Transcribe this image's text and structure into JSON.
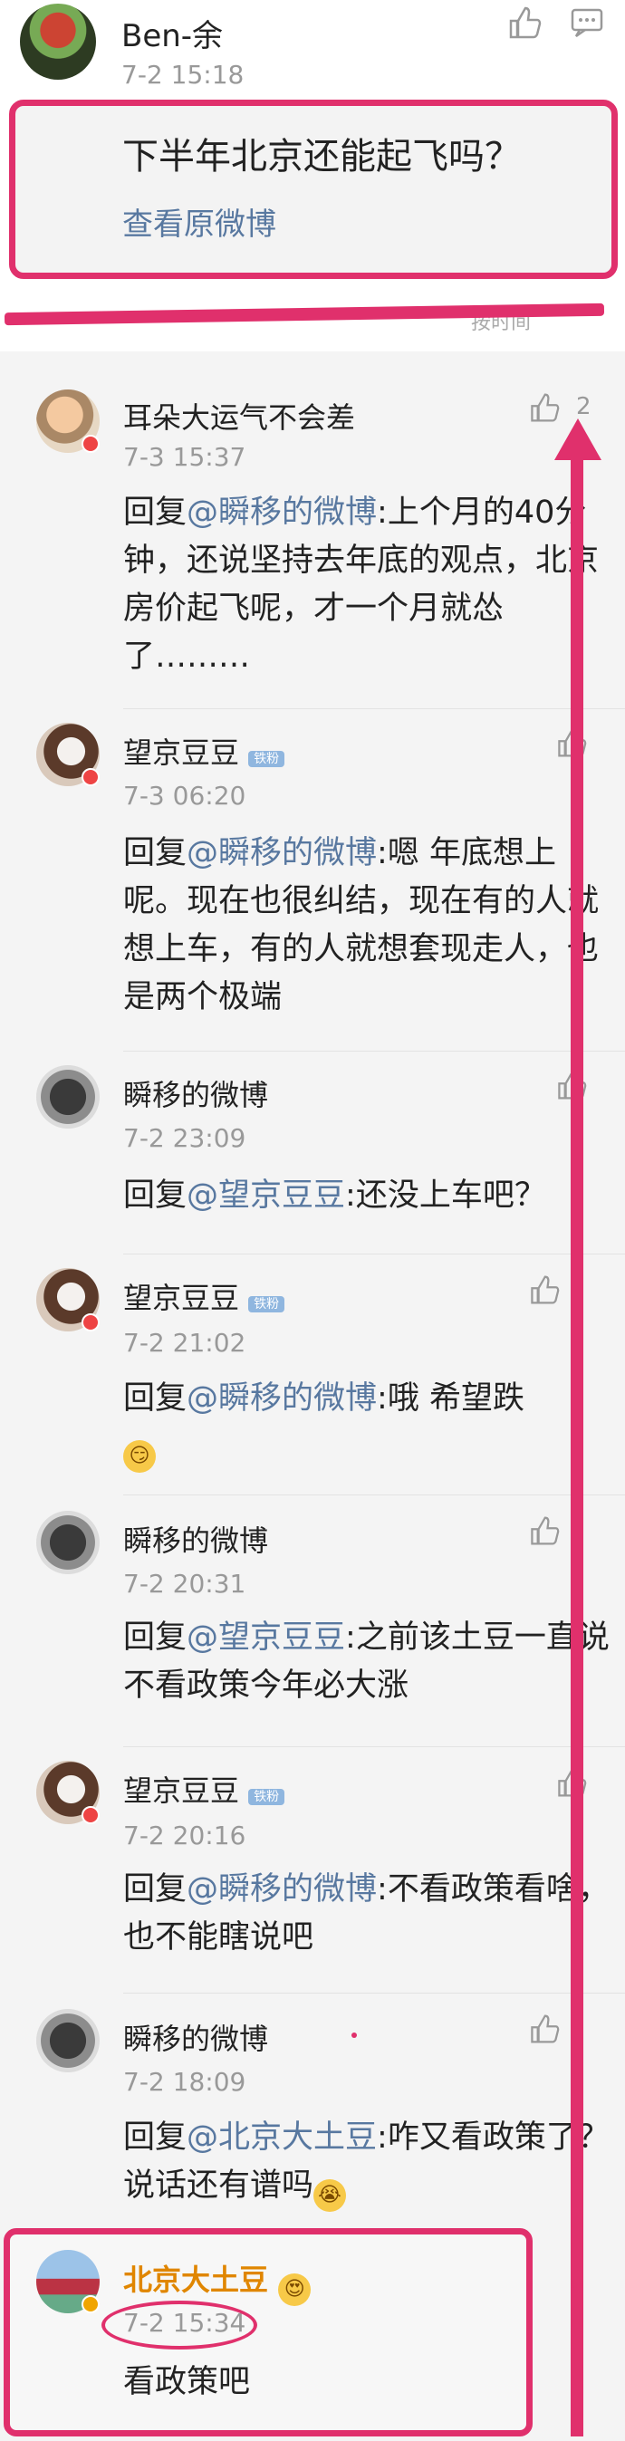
{
  "header": {
    "author": "Ben-余",
    "time": "7-2 15:18"
  },
  "original_post": {
    "title": "下半年北京还能起飞吗？",
    "link_label": "查看原微博"
  },
  "sort_hint": "按时间",
  "comments": [
    {
      "name": "耳朵大运气不会差",
      "time": "7-3 15:37",
      "likes": "2",
      "reply_prefix": "回复",
      "mention": "@瞬移的微博",
      "text": ":上个月的40分钟，还说坚持去年底的观点，北京房价起飞呢，才一个月就怂了………"
    },
    {
      "name": "望京豆豆",
      "tag": "铁粉",
      "time": "7-3 06:20",
      "reply_prefix": "回复",
      "mention": "@瞬移的微博",
      "text": ":嗯 年底想上呢。现在也很纠结，现在有的人就想上车，有的人就想套现走人，也是两个极端"
    },
    {
      "name": "瞬移的微博",
      "time": "7-2 23:09",
      "reply_prefix": "回复",
      "mention": "@望京豆豆",
      "text": ":还没上车吧？"
    },
    {
      "name": "望京豆豆",
      "tag": "铁粉",
      "time": "7-2 21:02",
      "reply_prefix": "回复",
      "mention": "@瞬移的微博",
      "text": ":哦 希望跌",
      "emoji": "😏"
    },
    {
      "name": "瞬移的微博",
      "time": "7-2 20:31",
      "reply_prefix": "回复",
      "mention": "@望京豆豆",
      "text": ":之前该土豆一直说不看政策今年必大涨"
    },
    {
      "name": "望京豆豆",
      "tag": "铁粉",
      "time": "7-2 20:16",
      "reply_prefix": "回复",
      "mention": "@瞬移的微博",
      "text": ":不看政策看啥，也不能瞎说吧"
    },
    {
      "name": "瞬移的微博",
      "time": "7-2 18:09",
      "reply_prefix": "回复",
      "mention": "@北京大土豆",
      "text": ":咋又看政策了？说话还有谱吗",
      "emoji": "😭"
    },
    {
      "name": "北京大土豆",
      "emoji_name": "😍",
      "time": "7-2 15:34",
      "text": "看政策吧"
    }
  ],
  "colors": {
    "annotation": "#e0306c",
    "link": "#5878a0",
    "gold_name": "#e08600"
  }
}
